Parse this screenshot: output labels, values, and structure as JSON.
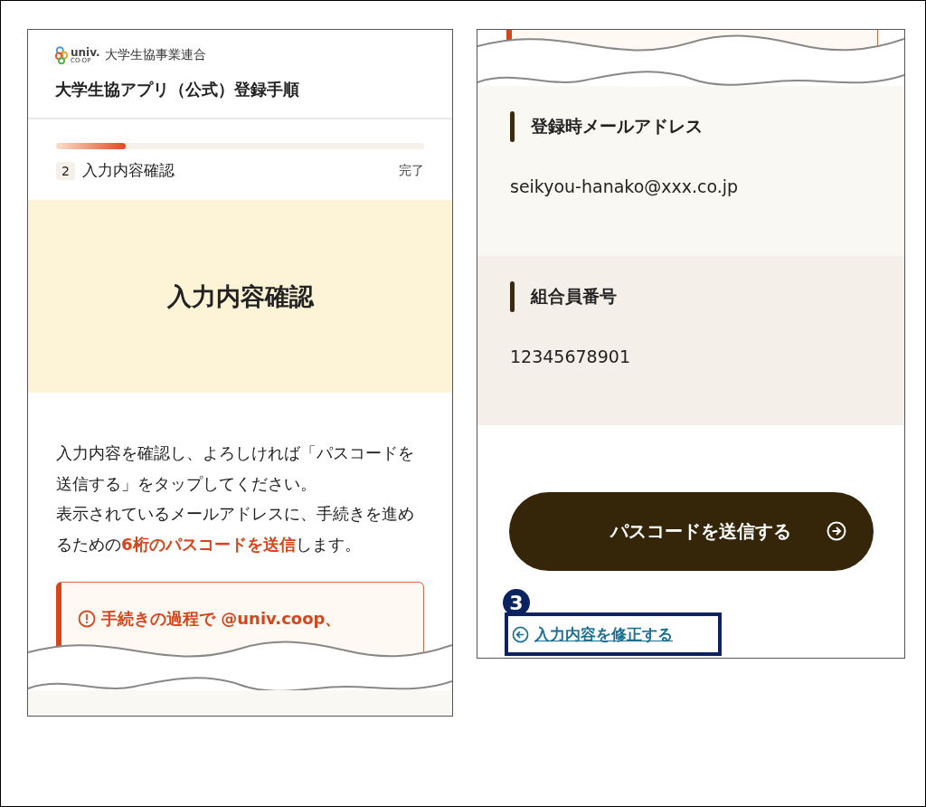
{
  "header": {
    "logo_text": "univ.",
    "logo_subtext": "CO·OP",
    "org_name": "大学生協事業連合",
    "title": "大学生協アプリ（公式）登録手順"
  },
  "progress": {
    "level": 0.19,
    "step_number": "2",
    "step_label": "入力内容確認",
    "end_label": "完了"
  },
  "hero": {
    "title": "入力内容確認"
  },
  "instructions": [
    "入力内容を確認し、よろしければ「パスコードを送信する」をタップしてください。",
    "表示されているメールアドレスに、手続きを進めるための**6桁のパスコードを送信**します。"
  ],
  "alert": {
    "text": "手続きの過程で @univ.coop、"
  },
  "fields": [
    {
      "label": "登録時メールアドレス",
      "value": "seikyou-hanako@xxx.co.jp"
    },
    {
      "label": "組合員番号",
      "value": "12345678901"
    }
  ],
  "submit_button": {
    "label": "パスコードを送信する"
  },
  "edit_link": {
    "label": "入力内容を修正する"
  },
  "callout": {
    "number": "3"
  }
}
